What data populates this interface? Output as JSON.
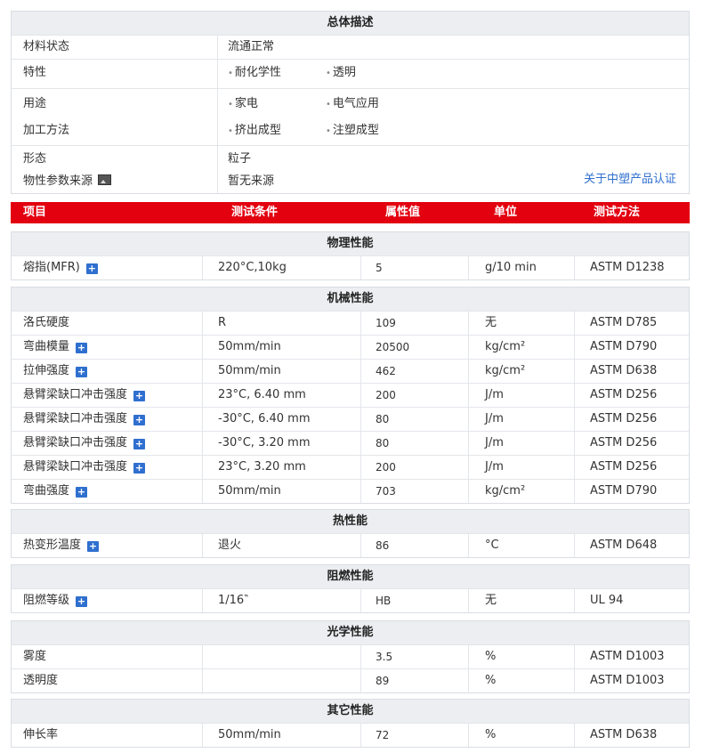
{
  "overview": {
    "title": "总体描述",
    "material_state": {
      "label": "材料状态",
      "value": "流通正常"
    },
    "features": {
      "label": "特性",
      "values": [
        "耐化学性",
        "透明"
      ]
    },
    "uses": {
      "label": "用途",
      "values": [
        "家电",
        "电气应用"
      ]
    },
    "processing": {
      "label": "加工方法",
      "values": [
        "挤出成型",
        "注塑成型"
      ]
    },
    "form": {
      "label": "形态",
      "value": "粒子"
    },
    "source": {
      "label": "物性参数来源",
      "value": "暂无来源"
    },
    "cert_link": "关于中塑产品认证"
  },
  "columns": [
    "项目",
    "测试条件",
    "属性值",
    "单位",
    "测试方法"
  ],
  "sections": [
    {
      "title": "物理性能",
      "rows": [
        [
          "熔指(MFR)",
          "220°C,10kg",
          "5",
          "g/10 min",
          "ASTM D1238"
        ]
      ]
    },
    {
      "title": "机械性能",
      "rows": [
        [
          "洛氏硬度",
          "R",
          "109",
          "无",
          "ASTM D785"
        ],
        [
          "弯曲模量",
          "50mm/min",
          "20500",
          "kg/cm²",
          "ASTM D790"
        ],
        [
          "拉伸强度",
          "50mm/min",
          "462",
          "kg/cm²",
          "ASTM D638"
        ],
        [
          "悬臂梁缺口冲击强度",
          "23°C, 6.40 mm",
          "200",
          "J/m",
          "ASTM D256"
        ],
        [
          "悬臂梁缺口冲击强度",
          "-30°C, 6.40 mm",
          "80",
          "J/m",
          "ASTM D256"
        ],
        [
          "悬臂梁缺口冲击强度",
          "-30°C, 3.20 mm",
          "80",
          "J/m",
          "ASTM D256"
        ],
        [
          "悬臂梁缺口冲击强度",
          "23°C, 3.20 mm",
          "200",
          "J/m",
          "ASTM D256"
        ],
        [
          "弯曲强度",
          "50mm/min",
          "703",
          "kg/cm²",
          "ASTM D790"
        ]
      ]
    },
    {
      "title": "热性能",
      "rows": [
        [
          "热变形温度",
          "退火",
          "86",
          "°C",
          "ASTM D648"
        ]
      ]
    },
    {
      "title": "阻燃性能",
      "rows": [
        [
          "阻燃等级",
          "1/16‶",
          "HB",
          "无",
          "UL 94"
        ]
      ]
    },
    {
      "title": "光学性能",
      "rows": [
        [
          "雾度",
          "",
          "3.5",
          "%",
          "ASTM D1003"
        ],
        [
          "透明度",
          "",
          "89",
          "%",
          "ASTM D1003"
        ]
      ]
    },
    {
      "title": "其它性能",
      "rows": [
        [
          "伸长率",
          "50mm/min",
          "72",
          "%",
          "ASTM D638"
        ]
      ]
    }
  ]
}
